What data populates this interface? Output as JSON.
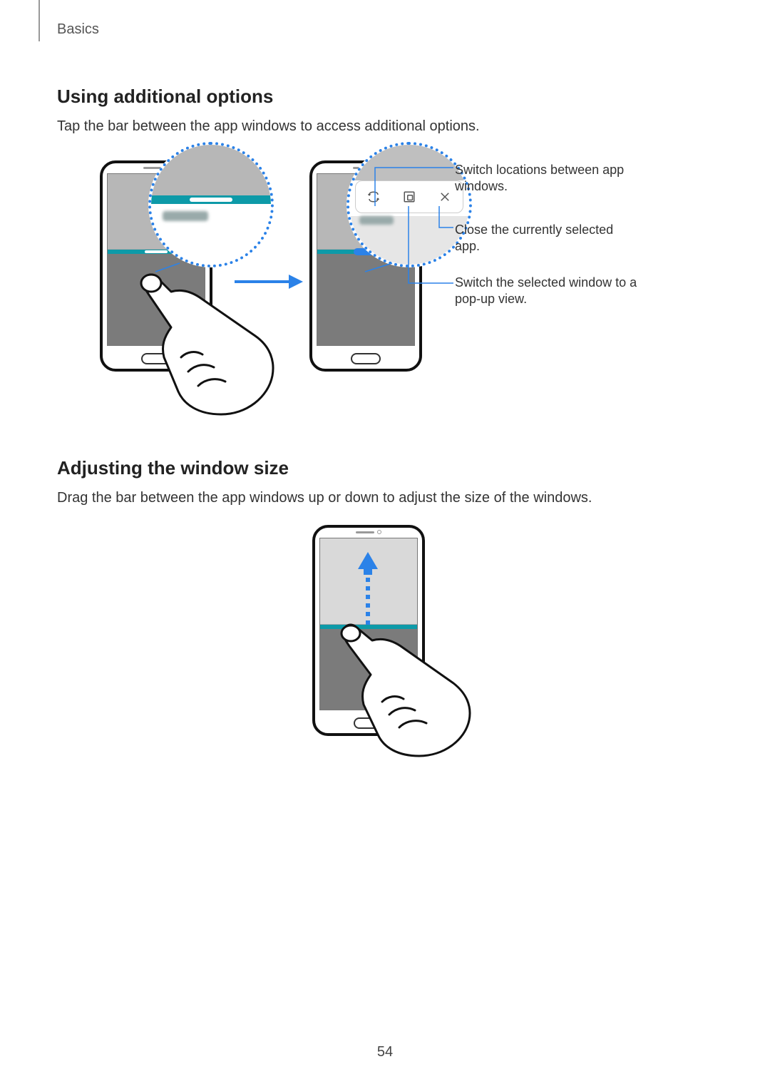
{
  "chapter": "Basics",
  "page_number": "54",
  "section1": {
    "title": "Using additional options",
    "body": "Tap the bar between the app windows to access additional options."
  },
  "callouts": {
    "switch_locations": "Switch locations between app windows.",
    "close_app": "Close the currently selected app.",
    "popup_view": "Switch the selected window to a pop-up view."
  },
  "icons": {
    "swap": "swap-icon",
    "popup": "popup-window-icon",
    "close": "close-icon"
  },
  "section2": {
    "title": "Adjusting the window size",
    "body": "Drag the bar between the app windows up or down to adjust the size of the windows."
  }
}
